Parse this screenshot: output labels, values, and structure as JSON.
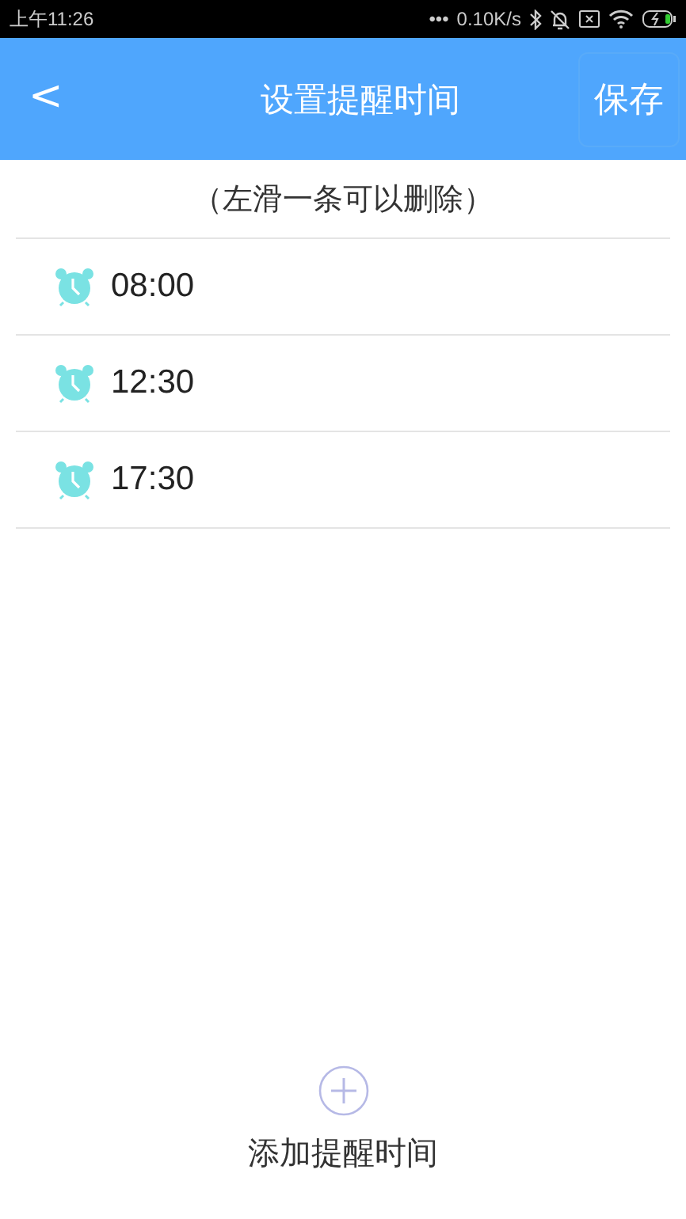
{
  "status_bar": {
    "time": "上午11:26",
    "dots": "•••",
    "speed": "0.10K/s"
  },
  "header": {
    "back": "<",
    "title": "设置提醒时间",
    "save": "保存"
  },
  "hint": "（左滑一条可以删除）",
  "reminders": [
    {
      "time": "08:00"
    },
    {
      "time": "12:30"
    },
    {
      "time": "17:30"
    }
  ],
  "add_button": {
    "label": "添加提醒时间"
  }
}
